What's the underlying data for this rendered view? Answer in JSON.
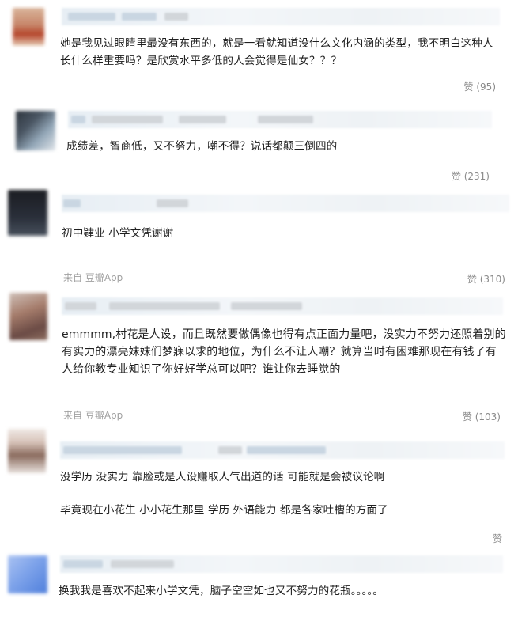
{
  "comments": [
    {
      "text": "她是我见过眼睛里最没有东西的，就是一看就知道没什么文化内涵的类型，我不明白这种人长什么样重要吗？是欣赏水平多低的人会觉得是仙女？？？",
      "likes_label": "赞 (95)",
      "avatar_colors": [
        "#c99b7d",
        "#b5452b",
        "#e2c6a8"
      ]
    },
    {
      "text": "成绩差，智商低，又不努力，嘲不得？说话都颠三倒四的",
      "likes_label": "赞 (231)",
      "avatar_colors": [
        "#3c4550",
        "#8aa0b2",
        "#c7ced6"
      ]
    },
    {
      "text": "初中肄业 小学文凭谢谢",
      "source": "来自 豆瓣App",
      "likes_label": "赞 (310)",
      "avatar_colors": [
        "#1b1d22",
        "#2a2f3a",
        "#47505c"
      ]
    },
    {
      "text": "emmmm,村花是人设，而且既然要做偶像也得有点正面力量吧，没实力不努力还照着别的有实力的漂亮妹妹们梦寐以求的地位，为什么不让人嘲？就算当时有困难那现在有钱了有人给你教专业知识了你好好学总可以吧？谁让你去睡觉的",
      "source": "来自 豆瓣App",
      "likes_label": "赞 (103)",
      "avatar_colors": [
        "#6b4b45",
        "#a57c6b",
        "#cfc0b8"
      ]
    },
    {
      "text_1": "没学历 没实力 靠脸或是人设赚取人气出道的话 可能就是会被议论啊",
      "text_2": "毕竟现在小花生 小小花生那里 学历 外语能力 都是各家吐槽的方面了",
      "likes_label": "赞",
      "avatar_colors": [
        "#e9e2de",
        "#8a6b5e",
        "#d8c4ba"
      ]
    },
    {
      "text": "换我我是喜欢不起来小学文凭，脑子空空如也又不努力的花瓶。。。。。",
      "avatar_colors": [
        "#4f7fdc",
        "#7ea3ea",
        "#a9c2f2"
      ]
    }
  ]
}
